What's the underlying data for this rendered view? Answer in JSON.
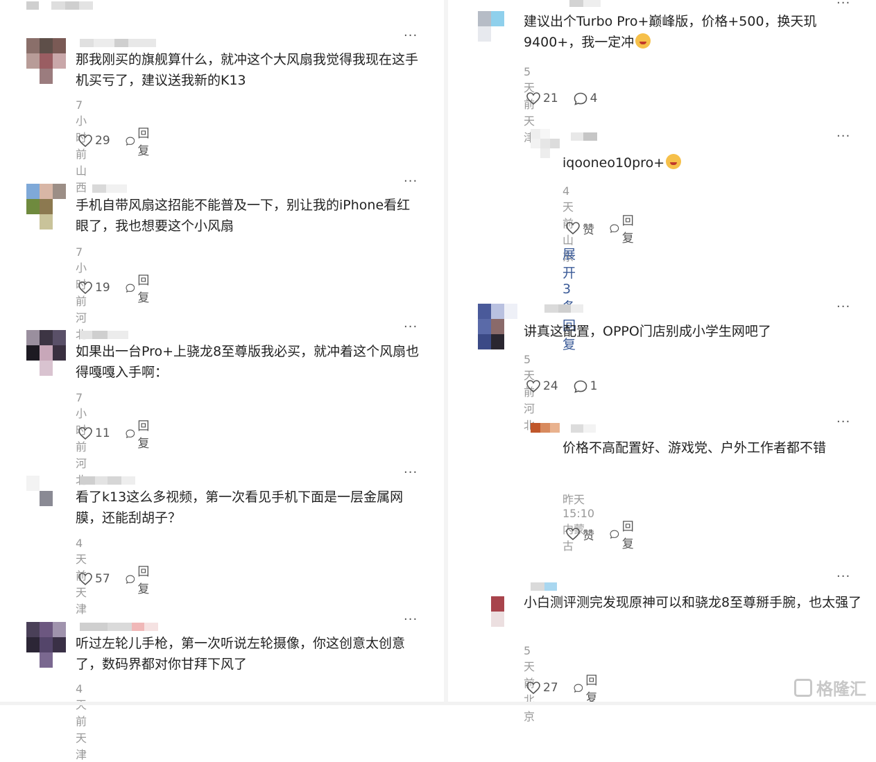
{
  "comments": [
    {
      "text": "那我刚买的旗舰算什么，就冲这个大风扇我觉得我现在这手机买亏了，建议送我新的K13",
      "time": "7小时前",
      "location": "山西",
      "likes": "29",
      "reply": "回复"
    },
    {
      "text": "手机自带风扇这招能不能普及一下，别让我的iPhone看红眼了，我也想要这个小风扇",
      "time": "7小时前",
      "location": "河北",
      "likes": "19",
      "reply": "回复"
    },
    {
      "text": "如果出一台Pro+上骁龙8至尊版我必买，就冲着这个风扇也得嘎嘎入手啊：",
      "time": "7小时前",
      "location": "河北",
      "likes": "11",
      "reply": "回复"
    },
    {
      "text": "看了k13这么多视频，第一次看见手机下面是一层金属网膜，还能刮胡子？",
      "time": "4天前",
      "location": "天津",
      "likes": "57",
      "reply": "回复"
    },
    {
      "text": "听过左轮儿手枪，第一次听说左轮摄像，你这创意太创意了，数码界都对你甘拜下风了",
      "time": "4天前",
      "location": "天津"
    },
    {
      "text": "建议出个Turbo Pro+巅峰版，价格+500，换天玑9400+，我一定冲",
      "time": "5天前",
      "location": "天津",
      "likes": "21",
      "replies": "4"
    },
    {
      "text": "iqooneo10pro+",
      "time": "4天前",
      "location": "山东",
      "likes": "赞",
      "reply": "回复"
    },
    {
      "text": "讲真这配置，OPPO门店别成小学生网吧了",
      "time": "5天前",
      "location": "河北",
      "likes": "24",
      "replies": "1"
    },
    {
      "text": "价格不高配置好、游戏党、户外工作者都不错",
      "time": "昨天 15:10",
      "location": "内蒙古",
      "likes": "赞",
      "reply": "回复"
    },
    {
      "text": "小白测评测完发现原神可以和骁龙8至尊掰手腕，也太强了",
      "time": "5天前",
      "location": "北京",
      "likes": "27",
      "reply": "回复"
    }
  ],
  "expand_replies": "展开 3 条回复",
  "more_label": "···",
  "watermark": "格隆汇",
  "icons": {
    "like": "heart-icon",
    "comment": "comment-bubble-icon",
    "emoji": "emoji-face-icon"
  }
}
